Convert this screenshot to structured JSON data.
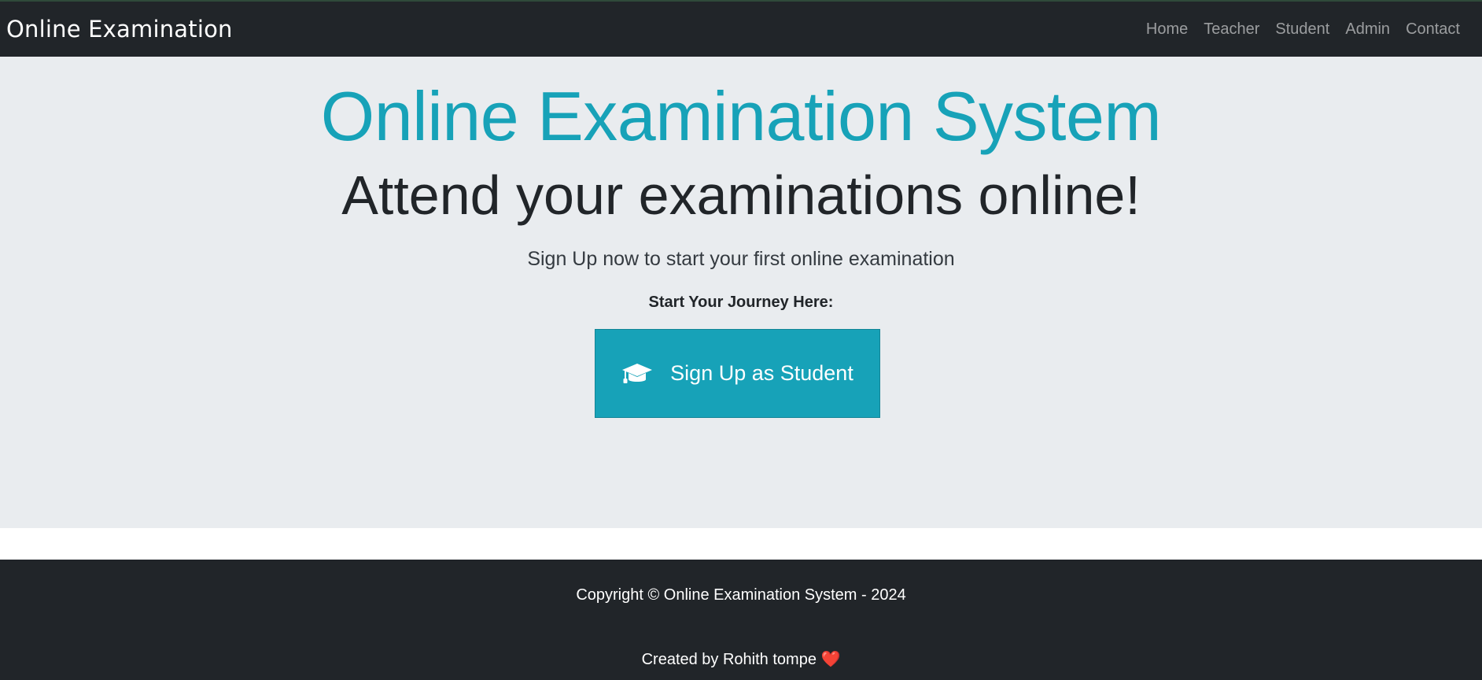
{
  "navbar": {
    "brand": "Online Examination",
    "links": [
      {
        "label": "Home"
      },
      {
        "label": "Teacher"
      },
      {
        "label": "Student"
      },
      {
        "label": "Admin"
      },
      {
        "label": "Contact"
      }
    ]
  },
  "hero": {
    "title": "Online Examination System",
    "subtitle": "Attend your examinations online!",
    "lead": "Sign Up now to start your first online examination",
    "journey_label": "Start Your Journey Here:",
    "signup_button": {
      "label": "Sign Up as Student",
      "icon": "graduation-cap-icon"
    }
  },
  "footer": {
    "copyright": "Copyright © Online Examination System - 2024",
    "credit": "Created by Rohith tompe",
    "credit_icon": "heart-icon",
    "heart_glyph": "❤️"
  },
  "colors": {
    "navbar_bg": "#212529",
    "accent": "#17a2b8",
    "hero_bg": "#e9ecef",
    "heart": "#e0245e"
  }
}
